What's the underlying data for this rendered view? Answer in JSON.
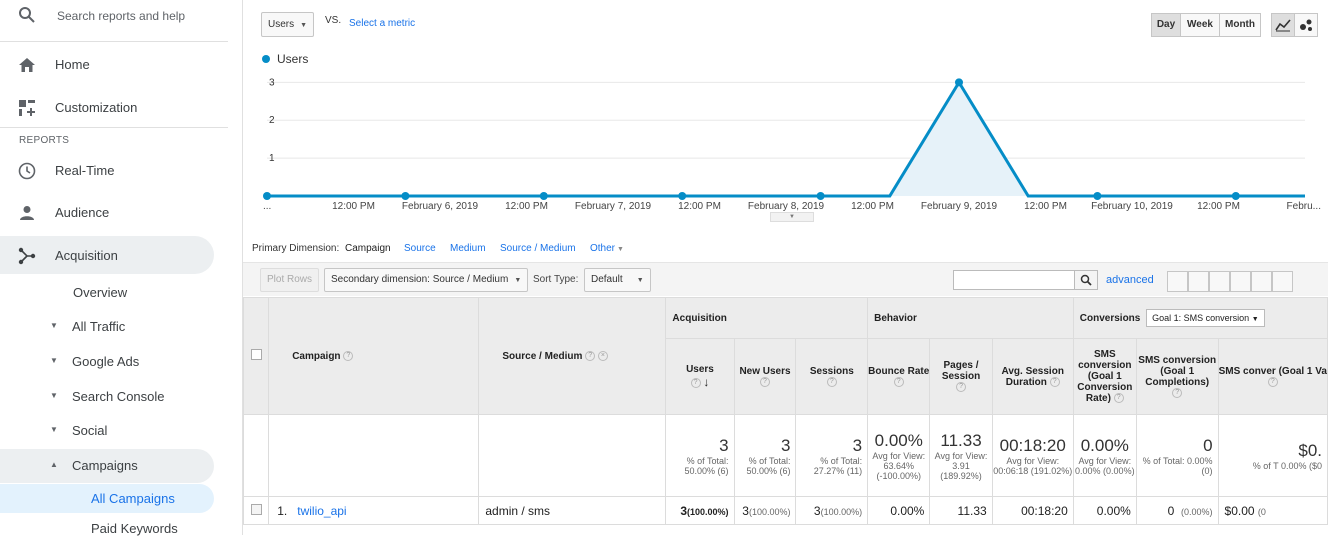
{
  "sidebar": {
    "search_placeholder": "Search reports and help",
    "home": "Home",
    "customization": "Customization",
    "reports_label": "REPORTS",
    "realtime": "Real-Time",
    "audience": "Audience",
    "acquisition": "Acquisition",
    "overview": "Overview",
    "all_traffic": "All Traffic",
    "google_ads": "Google Ads",
    "search_console": "Search Console",
    "social": "Social",
    "campaigns": "Campaigns",
    "all_campaigns": "All Campaigns",
    "paid_keywords": "Paid Keywords"
  },
  "chart_controls": {
    "metric": "Users",
    "vs": "VS.",
    "select_metric": "Select a metric",
    "day": "Day",
    "week": "Week",
    "month": "Month"
  },
  "chart_data": {
    "type": "area",
    "series": [
      {
        "name": "Users",
        "values": [
          0,
          0,
          0,
          0,
          0,
          0,
          0,
          0,
          0,
          0,
          3,
          0,
          0,
          0,
          0,
          0
        ]
      }
    ],
    "x_tick_labels": [
      "...",
      "12:00 PM",
      "February 6, 2019",
      "12:00 PM",
      "February 7, 2019",
      "12:00 PM",
      "February 8, 2019",
      "12:00 PM",
      "February 9, 2019",
      "12:00 PM",
      "February 10, 2019",
      "12:00 PM",
      "Febru..."
    ],
    "y_ticks": [
      "1",
      "2",
      "3"
    ],
    "ylim": [
      0,
      3.3
    ],
    "grid": true,
    "legend": "top-left",
    "color": "#058dc7"
  },
  "dimensions": {
    "label": "Primary Dimension:",
    "campaign": "Campaign",
    "source": "Source",
    "medium": "Medium",
    "source_medium": "Source / Medium",
    "other": "Other"
  },
  "toolbar": {
    "plot_rows": "Plot Rows",
    "secondary": "Secondary dimension: Source / Medium",
    "sort_type_label": "Sort Type:",
    "sort_type": "Default",
    "advanced": "advanced"
  },
  "table": {
    "groups": {
      "acquisition": "Acquisition",
      "behavior": "Behavior",
      "conversions": "Conversions",
      "goal_select": "Goal 1: SMS conversion"
    },
    "headers": {
      "campaign": "Campaign",
      "source_medium": "Source / Medium",
      "users": "Users",
      "new_users": "New Users",
      "sessions": "Sessions",
      "bounce_rate": "Bounce Rate",
      "pages_session": "Pages / Session",
      "avg_session": "Avg. Session Duration",
      "sms_conv_rate": "SMS conversion (Goal 1 Conversion Rate)",
      "sms_conv_compl": "SMS conversion (Goal 1 Completions)",
      "sms_conv_value": "SMS conver (Goal 1 Va"
    },
    "totals": {
      "users": "3",
      "users_sub": "% of Total: 50.00% (6)",
      "new_users": "3",
      "new_users_sub": "% of Total: 50.00% (6)",
      "sessions": "3",
      "sessions_sub": "% of Total: 27.27% (11)",
      "bounce": "0.00%",
      "bounce_sub": "Avg for View: 63.64% (-100.00%)",
      "pages": "11.33",
      "pages_sub": "Avg for View: 3.91 (189.92%)",
      "duration": "00:18:20",
      "duration_sub": "Avg for View: 00:06:18 (191.02%)",
      "conv_rate": "0.00%",
      "conv_rate_sub": "Avg for View: 0.00% (0.00%)",
      "compl": "0",
      "compl_sub": "% of Total: 0.00% (0)",
      "value": "$0.",
      "value_sub": "% of T 0.00% ($0"
    },
    "rows": [
      {
        "num": "1.",
        "campaign": "twilio_api",
        "source_medium": "admin / sms",
        "users": "3",
        "users_pct": "(100.00%)",
        "new_users": "3",
        "new_users_pct": "(100.00%)",
        "sessions": "3",
        "sessions_pct": "(100.00%)",
        "bounce": "0.00%",
        "pages": "11.33",
        "duration": "00:18:20",
        "conv_rate": "0.00%",
        "compl": "0",
        "compl_pct": "(0.00%)",
        "value": "$0.00",
        "value_pct": "(0"
      }
    ]
  }
}
